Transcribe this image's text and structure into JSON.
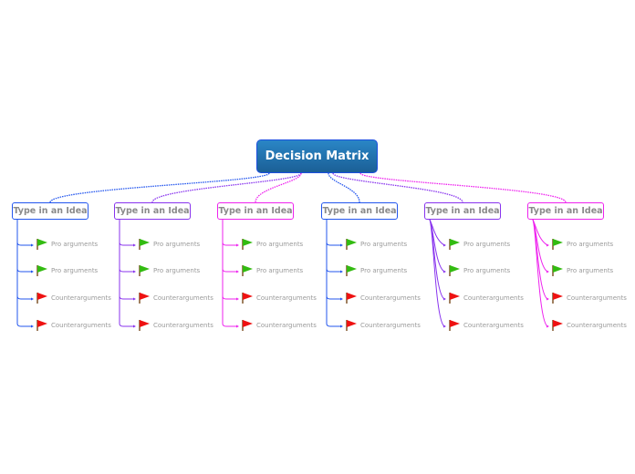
{
  "root": {
    "label": "Decision Matrix"
  },
  "colors": {
    "blue": "#2255ee",
    "purple": "#8833ee",
    "magenta": "#ee22ee",
    "pro_flag": "#33bb11",
    "con_flag": "#ee1111"
  },
  "topics": [
    {
      "label": "Type in an Idea",
      "color": "#2255ee",
      "subtopics": [
        {
          "label": "Pro arguments",
          "flag": "green-flag"
        },
        {
          "label": "Pro arguments",
          "flag": "green-flag"
        },
        {
          "label": "Counterarguments",
          "flag": "red-flag"
        },
        {
          "label": "Counterarguments",
          "flag": "red-flag"
        }
      ]
    },
    {
      "label": "Type in an Idea",
      "color": "#8833ee",
      "subtopics": [
        {
          "label": "Pro arguments",
          "flag": "green-flag"
        },
        {
          "label": "Pro arguments",
          "flag": "green-flag"
        },
        {
          "label": "Counterarguments",
          "flag": "red-flag"
        },
        {
          "label": "Counterarguments",
          "flag": "red-flag"
        }
      ]
    },
    {
      "label": "Type in an Idea",
      "color": "#ee22ee",
      "subtopics": [
        {
          "label": "Pro arguments",
          "flag": "green-flag"
        },
        {
          "label": "Pro arguments",
          "flag": "green-flag"
        },
        {
          "label": "Counterarguments",
          "flag": "red-flag"
        },
        {
          "label": "Counterarguments",
          "flag": "red-flag"
        }
      ]
    },
    {
      "label": "Type in an Idea",
      "color": "#2255ee",
      "subtopics": [
        {
          "label": "Pro arguments",
          "flag": "green-flag"
        },
        {
          "label": "Pro arguments",
          "flag": "green-flag"
        },
        {
          "label": "Counterarguments",
          "flag": "red-flag"
        },
        {
          "label": "Counterarguments",
          "flag": "red-flag"
        }
      ]
    },
    {
      "label": "Type in an Idea",
      "color": "#8833ee",
      "subtopics": [
        {
          "label": "Pro arguments",
          "flag": "green-flag"
        },
        {
          "label": "Pro arguments",
          "flag": "green-flag"
        },
        {
          "label": "Counterarguments",
          "flag": "red-flag"
        },
        {
          "label": "Counterarguments",
          "flag": "red-flag"
        }
      ]
    },
    {
      "label": "Type in an Idea",
      "color": "#ee22ee",
      "subtopics": [
        {
          "label": "Pro arguments",
          "flag": "green-flag"
        },
        {
          "label": "Pro arguments",
          "flag": "green-flag"
        },
        {
          "label": "Counterarguments",
          "flag": "red-flag"
        },
        {
          "label": "Counterarguments",
          "flag": "red-flag"
        }
      ]
    }
  ]
}
